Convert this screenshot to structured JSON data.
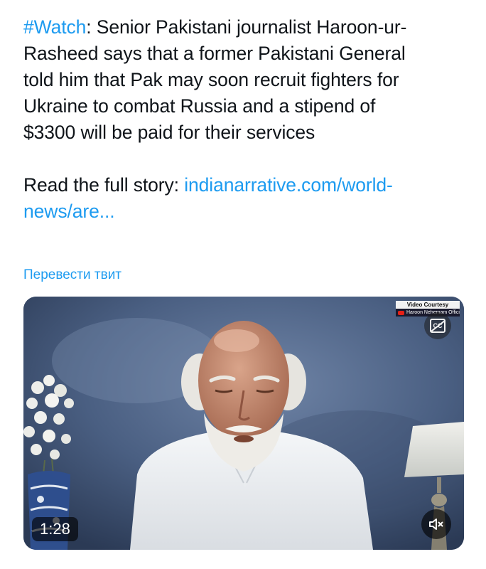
{
  "tweet": {
    "hashtag": "#Watch",
    "line1_rest": ": Senior Pakistani journalist Haroon-ur-",
    "line2": "Rasheed says that a former Pakistani General",
    "line3": "told him that Pak may soon recruit fighters for",
    "line4": "Ukraine to combat Russia and a stipend of",
    "line5": "$3300 will be paid for their services",
    "read_prefix": "Read the full story: ",
    "link_line1": "indianarrative.com/world-",
    "link_line2": "news/are..."
  },
  "translate_label": "Перевести твит",
  "video": {
    "courtesy_title": "Video Courtesy",
    "courtesy_channel": "Haroon Nehemam Official",
    "cc_label": "CC",
    "duration": "1:28"
  },
  "colors": {
    "link": "#1d9bf0",
    "text": "#0f1419"
  },
  "icons": {
    "captions": "captions-off-icon",
    "mute": "speaker-muted-icon",
    "channel": "youtube-icon"
  }
}
